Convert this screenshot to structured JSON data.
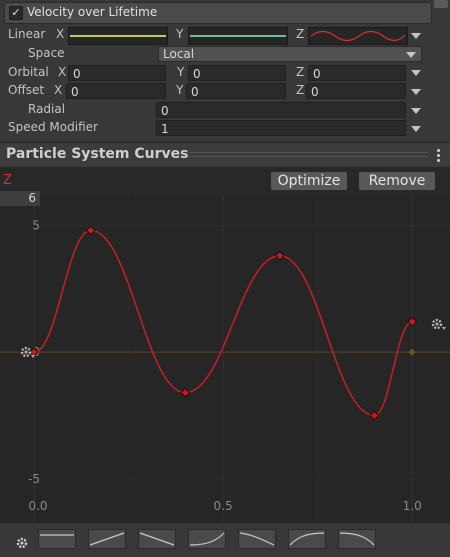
{
  "module": {
    "enabled": true,
    "title": "Velocity over Lifetime",
    "check_glyph": "✓"
  },
  "linear": {
    "label": "Linear",
    "x_label": "X",
    "y_label": "Y",
    "z_label": "Z",
    "x_color": "#c9c95a",
    "y_color": "#6ec28e",
    "z_color": "#d8302c"
  },
  "space": {
    "label": "Space",
    "value": "Local"
  },
  "orbital": {
    "label": "Orbital",
    "x_label": "X",
    "y_label": "Y",
    "z_label": "Z",
    "x": "0",
    "y": "0",
    "z": "0"
  },
  "offset": {
    "label": "Offset",
    "x_label": "X",
    "y_label": "Y",
    "z_label": "Z",
    "x": "0",
    "y": "0",
    "z": "0"
  },
  "radial": {
    "label": "Radial",
    "value": "0"
  },
  "speed_modifier": {
    "label": "Speed Modifier",
    "value": "1"
  },
  "curves_panel": {
    "title": "Particle System Curves",
    "channel_label": "Z",
    "max_value": "6",
    "optimize_label": "Optimize",
    "remove_label": "Remove",
    "curve_color": "#cc1f1f",
    "gear_icon": "gear-icon",
    "settings_icon": "gear-icon"
  },
  "chart_data": {
    "type": "line",
    "series": [
      {
        "name": "Z",
        "keys": [
          {
            "x": 0.0,
            "y": 0.0
          },
          {
            "x": 0.15,
            "y": 4.8
          },
          {
            "x": 0.4,
            "y": -1.6
          },
          {
            "x": 0.65,
            "y": 3.8
          },
          {
            "x": 0.9,
            "y": -2.5
          },
          {
            "x": 1.0,
            "y": 1.2
          }
        ]
      }
    ],
    "xlim": [
      -0.09,
      1.1
    ],
    "ylim": [
      -6.7,
      7.3
    ],
    "xticks": [
      "0.0",
      "0.5",
      "1.0"
    ],
    "yticks": [
      "5",
      "0",
      "-5"
    ],
    "grid": true
  }
}
